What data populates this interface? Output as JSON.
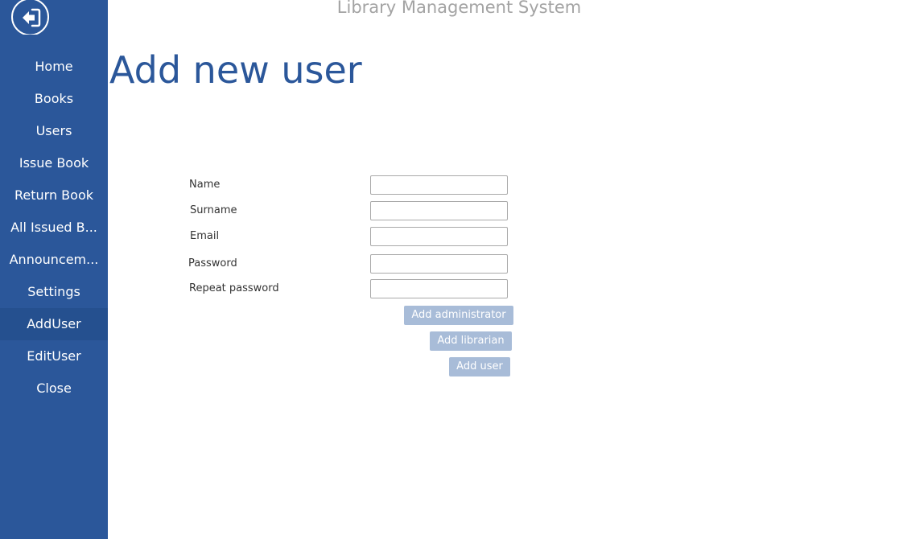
{
  "app": {
    "title": "Library Management System"
  },
  "sidebar": {
    "back_icon": "back-arrow-circle-icon",
    "items": [
      {
        "label": "Home"
      },
      {
        "label": "Books"
      },
      {
        "label": "Users"
      },
      {
        "label": "Issue Book"
      },
      {
        "label": "Return Book"
      },
      {
        "label": "All Issued B..."
      },
      {
        "label": "Announcem..."
      },
      {
        "label": "Settings"
      },
      {
        "label": "AddUser",
        "active": true
      },
      {
        "label": "EditUser"
      },
      {
        "label": "Close"
      }
    ]
  },
  "main": {
    "page_title": "Add new user",
    "form": {
      "fields": [
        {
          "label": "Name",
          "value": ""
        },
        {
          "label": "Surname",
          "value": ""
        },
        {
          "label": "Email",
          "value": ""
        },
        {
          "label": "Password",
          "value": ""
        },
        {
          "label": "Repeat password",
          "value": ""
        }
      ],
      "buttons": {
        "add_administrator": "Add administrator",
        "add_librarian": "Add librarian",
        "add_user": "Add user"
      }
    }
  },
  "colors": {
    "sidebar_bg": "#2b579a",
    "sidebar_active_bg": "#25508f",
    "accent": "#2b579a",
    "button_bg": "#a8bcd8",
    "app_title": "#a3a3a3"
  }
}
